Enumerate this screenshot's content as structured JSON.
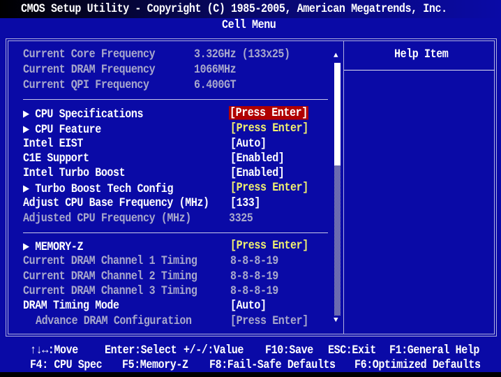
{
  "header": {
    "title": "CMOS Setup Utility - Copyright (C) 1985-2005, American Megatrends, Inc.",
    "subtitle": "Cell Menu"
  },
  "info_rows": [
    {
      "label": "Current Core Frequency",
      "value": "3.32GHz (133x25)"
    },
    {
      "label": "Current DRAM Frequency",
      "value": "1066MHz"
    },
    {
      "label": "Current QPI Frequency",
      "value": "6.400GT"
    }
  ],
  "cpu_rows": [
    {
      "label": "▶ CPU Specifications",
      "value": "[Press Enter]"
    },
    {
      "label": "▶ CPU Feature",
      "value": "[Press Enter]"
    },
    {
      "label": "Intel EIST",
      "value": "[Auto]"
    },
    {
      "label": "C1E Support",
      "value": "[Enabled]"
    },
    {
      "label": "Intel Turbo Boost",
      "value": "[Enabled]"
    },
    {
      "label": "▶ Turbo Boost Tech Config",
      "value": "[Press Enter]"
    },
    {
      "label": "Adjust CPU Base Frequency (MHz)",
      "value": "[133]"
    },
    {
      "label": "Adjusted CPU Frequency (MHz)",
      "value": "3325"
    }
  ],
  "mem_rows": [
    {
      "label": "▶ MEMORY-Z",
      "value": "[Press Enter]"
    },
    {
      "label": "Current DRAM Channel 1 Timing",
      "value": "8-8-8-19"
    },
    {
      "label": "Current DRAM Channel 2 Timing",
      "value": "8-8-8-19"
    },
    {
      "label": "Current DRAM Channel 3 Timing",
      "value": "8-8-8-19"
    },
    {
      "label": "DRAM Timing Mode",
      "value": "[Auto]"
    },
    {
      "label": "Advance DRAM Configuration",
      "value": "[Press Enter]"
    }
  ],
  "help": {
    "title": "Help Item"
  },
  "scrollbar": {
    "up": "▲",
    "down": "▼",
    "position_fraction": 0
  },
  "footer": {
    "line1": [
      "↑↓↔:Move",
      "Enter:Select",
      "+/-/:Value",
      "F10:Save",
      "ESC:Exit",
      "F1:General Help"
    ],
    "line2": [
      "F4: CPU Spec",
      "F5:Memory-Z",
      "F8:Fail-Safe Defaults",
      "F6:Optimized Defaults"
    ]
  },
  "colors": {
    "background": "#0a0aa6",
    "highlight": "#b00000",
    "submenu": "#f0f070",
    "disabled": "#a8a8cc"
  }
}
